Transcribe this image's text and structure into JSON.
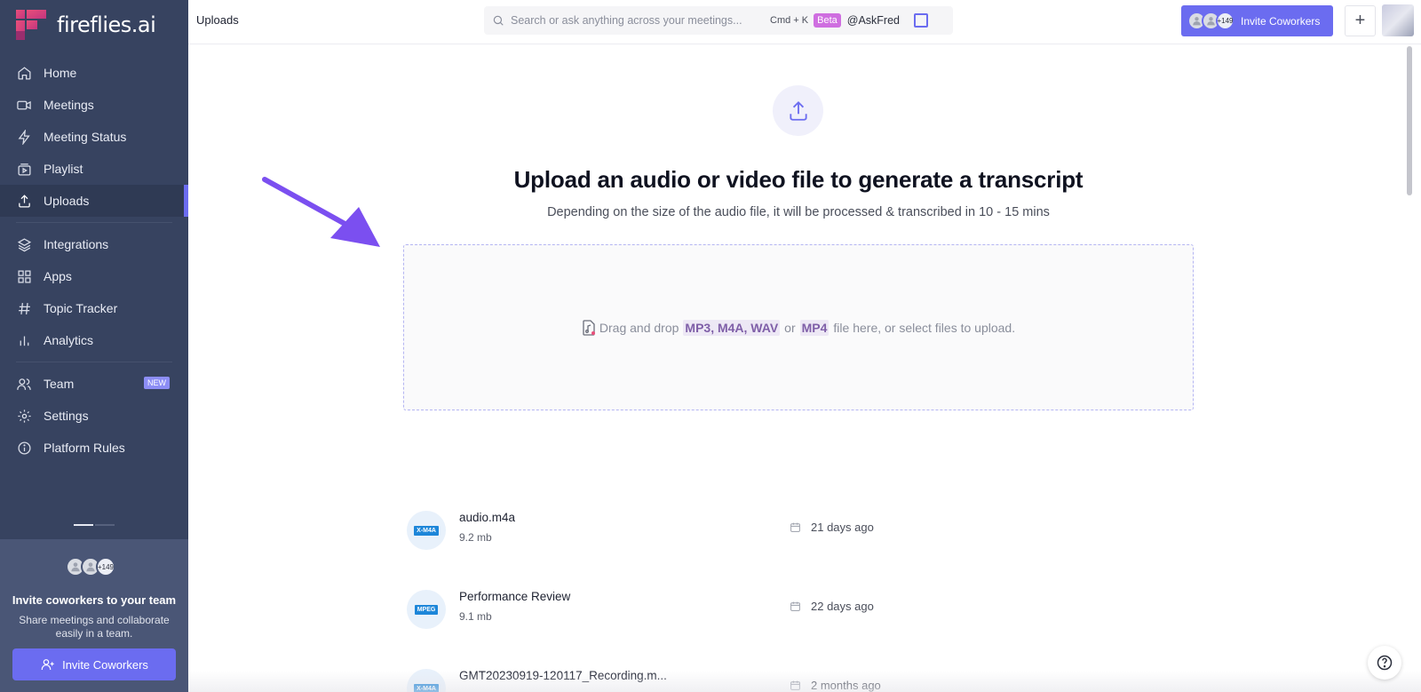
{
  "app": {
    "logo_text": "fireflies.ai",
    "accent": "#6b6cf0"
  },
  "sidebar": {
    "items": [
      {
        "label": "Home",
        "icon": "home-icon"
      },
      {
        "label": "Meetings",
        "icon": "video-icon"
      },
      {
        "label": "Meeting Status",
        "icon": "bolt-icon"
      },
      {
        "label": "Playlist",
        "icon": "playlist-icon"
      },
      {
        "label": "Uploads",
        "icon": "upload-icon",
        "active": true
      },
      {
        "label": "Integrations",
        "icon": "layers-icon"
      },
      {
        "label": "Apps",
        "icon": "grid-icon"
      },
      {
        "label": "Topic Tracker",
        "icon": "hash-icon"
      },
      {
        "label": "Analytics",
        "icon": "bar-chart-icon"
      },
      {
        "label": "Team",
        "icon": "users-icon",
        "badge": "NEW"
      },
      {
        "label": "Settings",
        "icon": "gear-icon"
      },
      {
        "label": "Platform Rules",
        "icon": "info-icon"
      }
    ],
    "invite_panel": {
      "avatar_count": "+149",
      "title": "Invite coworkers to your team",
      "subtitle": "Share meetings and collaborate easily in a team.",
      "button_label": "Invite Coworkers"
    }
  },
  "header": {
    "title": "Uploads",
    "search_placeholder": "Search or ask anything across your meetings...",
    "shortcut": "Cmd + K",
    "beta_badge": "Beta",
    "askfred_label": "@AskFred",
    "invite_count": "+149",
    "invite_label": "Invite Coworkers",
    "plus_label": "+"
  },
  "main": {
    "title": "Upload an audio or video file to generate a transcript",
    "subtitle": "Depending on the size of the audio file, it will be processed & transcribed in 10 - 15 mins",
    "dropzone": {
      "prefix": "Drag and drop",
      "formats": "MP3, M4A, WAV",
      "or": "or",
      "format2": "MP4",
      "suffix": "file here, or select files to upload."
    },
    "files": [
      {
        "tag": "X-M4A",
        "name": "audio.m4a",
        "size": "9.2 mb",
        "date": "21 days ago"
      },
      {
        "tag": "MPEG",
        "name": "Performance Review",
        "size": "9.1 mb",
        "date": "22 days ago"
      },
      {
        "tag": "X-M4A",
        "name": "GMT20230919-120117_Recording.m...",
        "size": "",
        "date": "2 months ago"
      }
    ]
  }
}
